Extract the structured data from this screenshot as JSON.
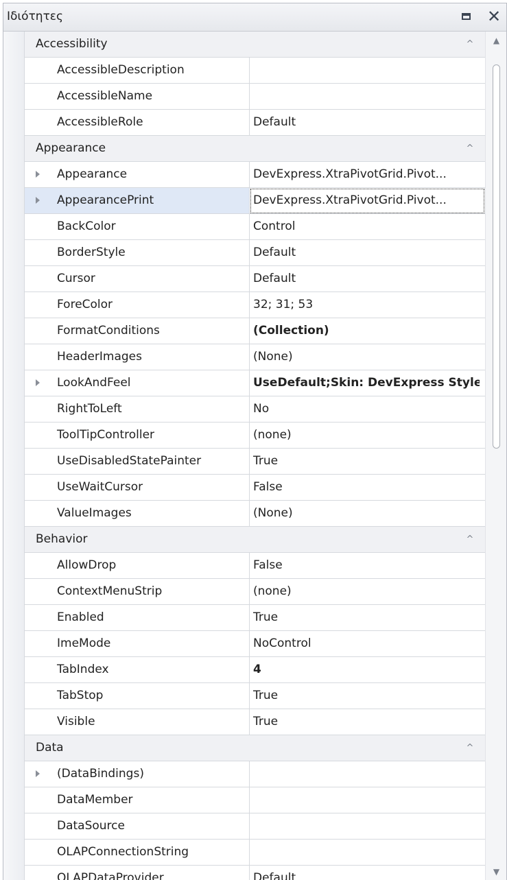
{
  "window": {
    "title": "Ιδιότητες"
  },
  "rows": [
    {
      "type": "category",
      "label": "Accessibility"
    },
    {
      "type": "prop",
      "name": "AccessibleDescription",
      "value": ""
    },
    {
      "type": "prop",
      "name": "AccessibleName",
      "value": ""
    },
    {
      "type": "prop",
      "name": "AccessibleRole",
      "value": "Default"
    },
    {
      "type": "category",
      "label": "Appearance"
    },
    {
      "type": "prop",
      "name": "Appearance",
      "value": "DevExpress.XtraPivotGrid.Pivot...",
      "expandable": true
    },
    {
      "type": "prop",
      "name": "AppearancePrint",
      "value": "DevExpress.XtraPivotGrid.Pivot...",
      "expandable": true,
      "selected": true
    },
    {
      "type": "prop",
      "name": "BackColor",
      "value": "Control"
    },
    {
      "type": "prop",
      "name": "BorderStyle",
      "value": "Default"
    },
    {
      "type": "prop",
      "name": "Cursor",
      "value": "Default"
    },
    {
      "type": "prop",
      "name": "ForeColor",
      "value": "32; 31; 53"
    },
    {
      "type": "prop",
      "name": "FormatConditions",
      "value": "(Collection)",
      "bold": true
    },
    {
      "type": "prop",
      "name": "HeaderImages",
      "value": "(None)"
    },
    {
      "type": "prop",
      "name": "LookAndFeel",
      "value": "UseDefault;Skin: DevExpress Style",
      "expandable": true,
      "bold": true
    },
    {
      "type": "prop",
      "name": "RightToLeft",
      "value": "No"
    },
    {
      "type": "prop",
      "name": "ToolTipController",
      "value": "(none)"
    },
    {
      "type": "prop",
      "name": "UseDisabledStatePainter",
      "value": "True"
    },
    {
      "type": "prop",
      "name": "UseWaitCursor",
      "value": "False"
    },
    {
      "type": "prop",
      "name": "ValueImages",
      "value": "(None)"
    },
    {
      "type": "category",
      "label": "Behavior"
    },
    {
      "type": "prop",
      "name": "AllowDrop",
      "value": "False"
    },
    {
      "type": "prop",
      "name": "ContextMenuStrip",
      "value": "(none)"
    },
    {
      "type": "prop",
      "name": "Enabled",
      "value": "True"
    },
    {
      "type": "prop",
      "name": "ImeMode",
      "value": "NoControl"
    },
    {
      "type": "prop",
      "name": "TabIndex",
      "value": "4",
      "bold": true
    },
    {
      "type": "prop",
      "name": "TabStop",
      "value": "True"
    },
    {
      "type": "prop",
      "name": "Visible",
      "value": "True"
    },
    {
      "type": "category",
      "label": "Data"
    },
    {
      "type": "prop",
      "name": "(DataBindings)",
      "value": "",
      "expandable": true
    },
    {
      "type": "prop",
      "name": "DataMember",
      "value": ""
    },
    {
      "type": "prop",
      "name": "DataSource",
      "value": ""
    },
    {
      "type": "prop",
      "name": "OLAPConnectionString",
      "value": ""
    },
    {
      "type": "prop",
      "name": "OLAPDataProvider",
      "value": "Default"
    },
    {
      "type": "prop",
      "name": "",
      "value": ""
    }
  ]
}
